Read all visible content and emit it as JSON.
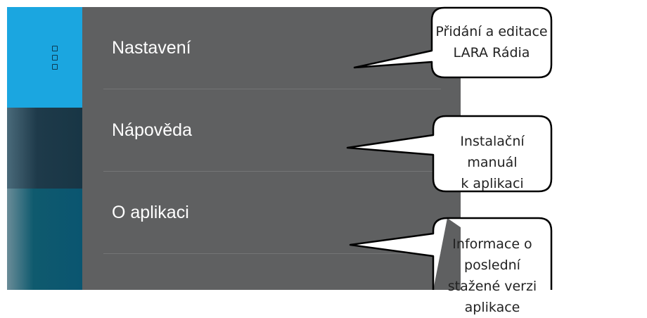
{
  "menu": {
    "items": [
      {
        "label": "Nastavení"
      },
      {
        "label": "Nápověda"
      },
      {
        "label": "O aplikaci"
      }
    ]
  },
  "strip": {
    "icon": "more-icon",
    "accent_color": "#1ba6e0"
  },
  "callouts": [
    {
      "lines": [
        "Přidání a editace",
        "LARA Rádia"
      ]
    },
    {
      "lines": [
        "Instalační manuál",
        "k aplikaci"
      ]
    },
    {
      "lines": [
        "Informace o poslední",
        "stažené verzi aplikace"
      ]
    }
  ],
  "colors": {
    "menu_bg": "#5f6061",
    "menu_text": "#ffffff",
    "callout_border": "#000000"
  }
}
